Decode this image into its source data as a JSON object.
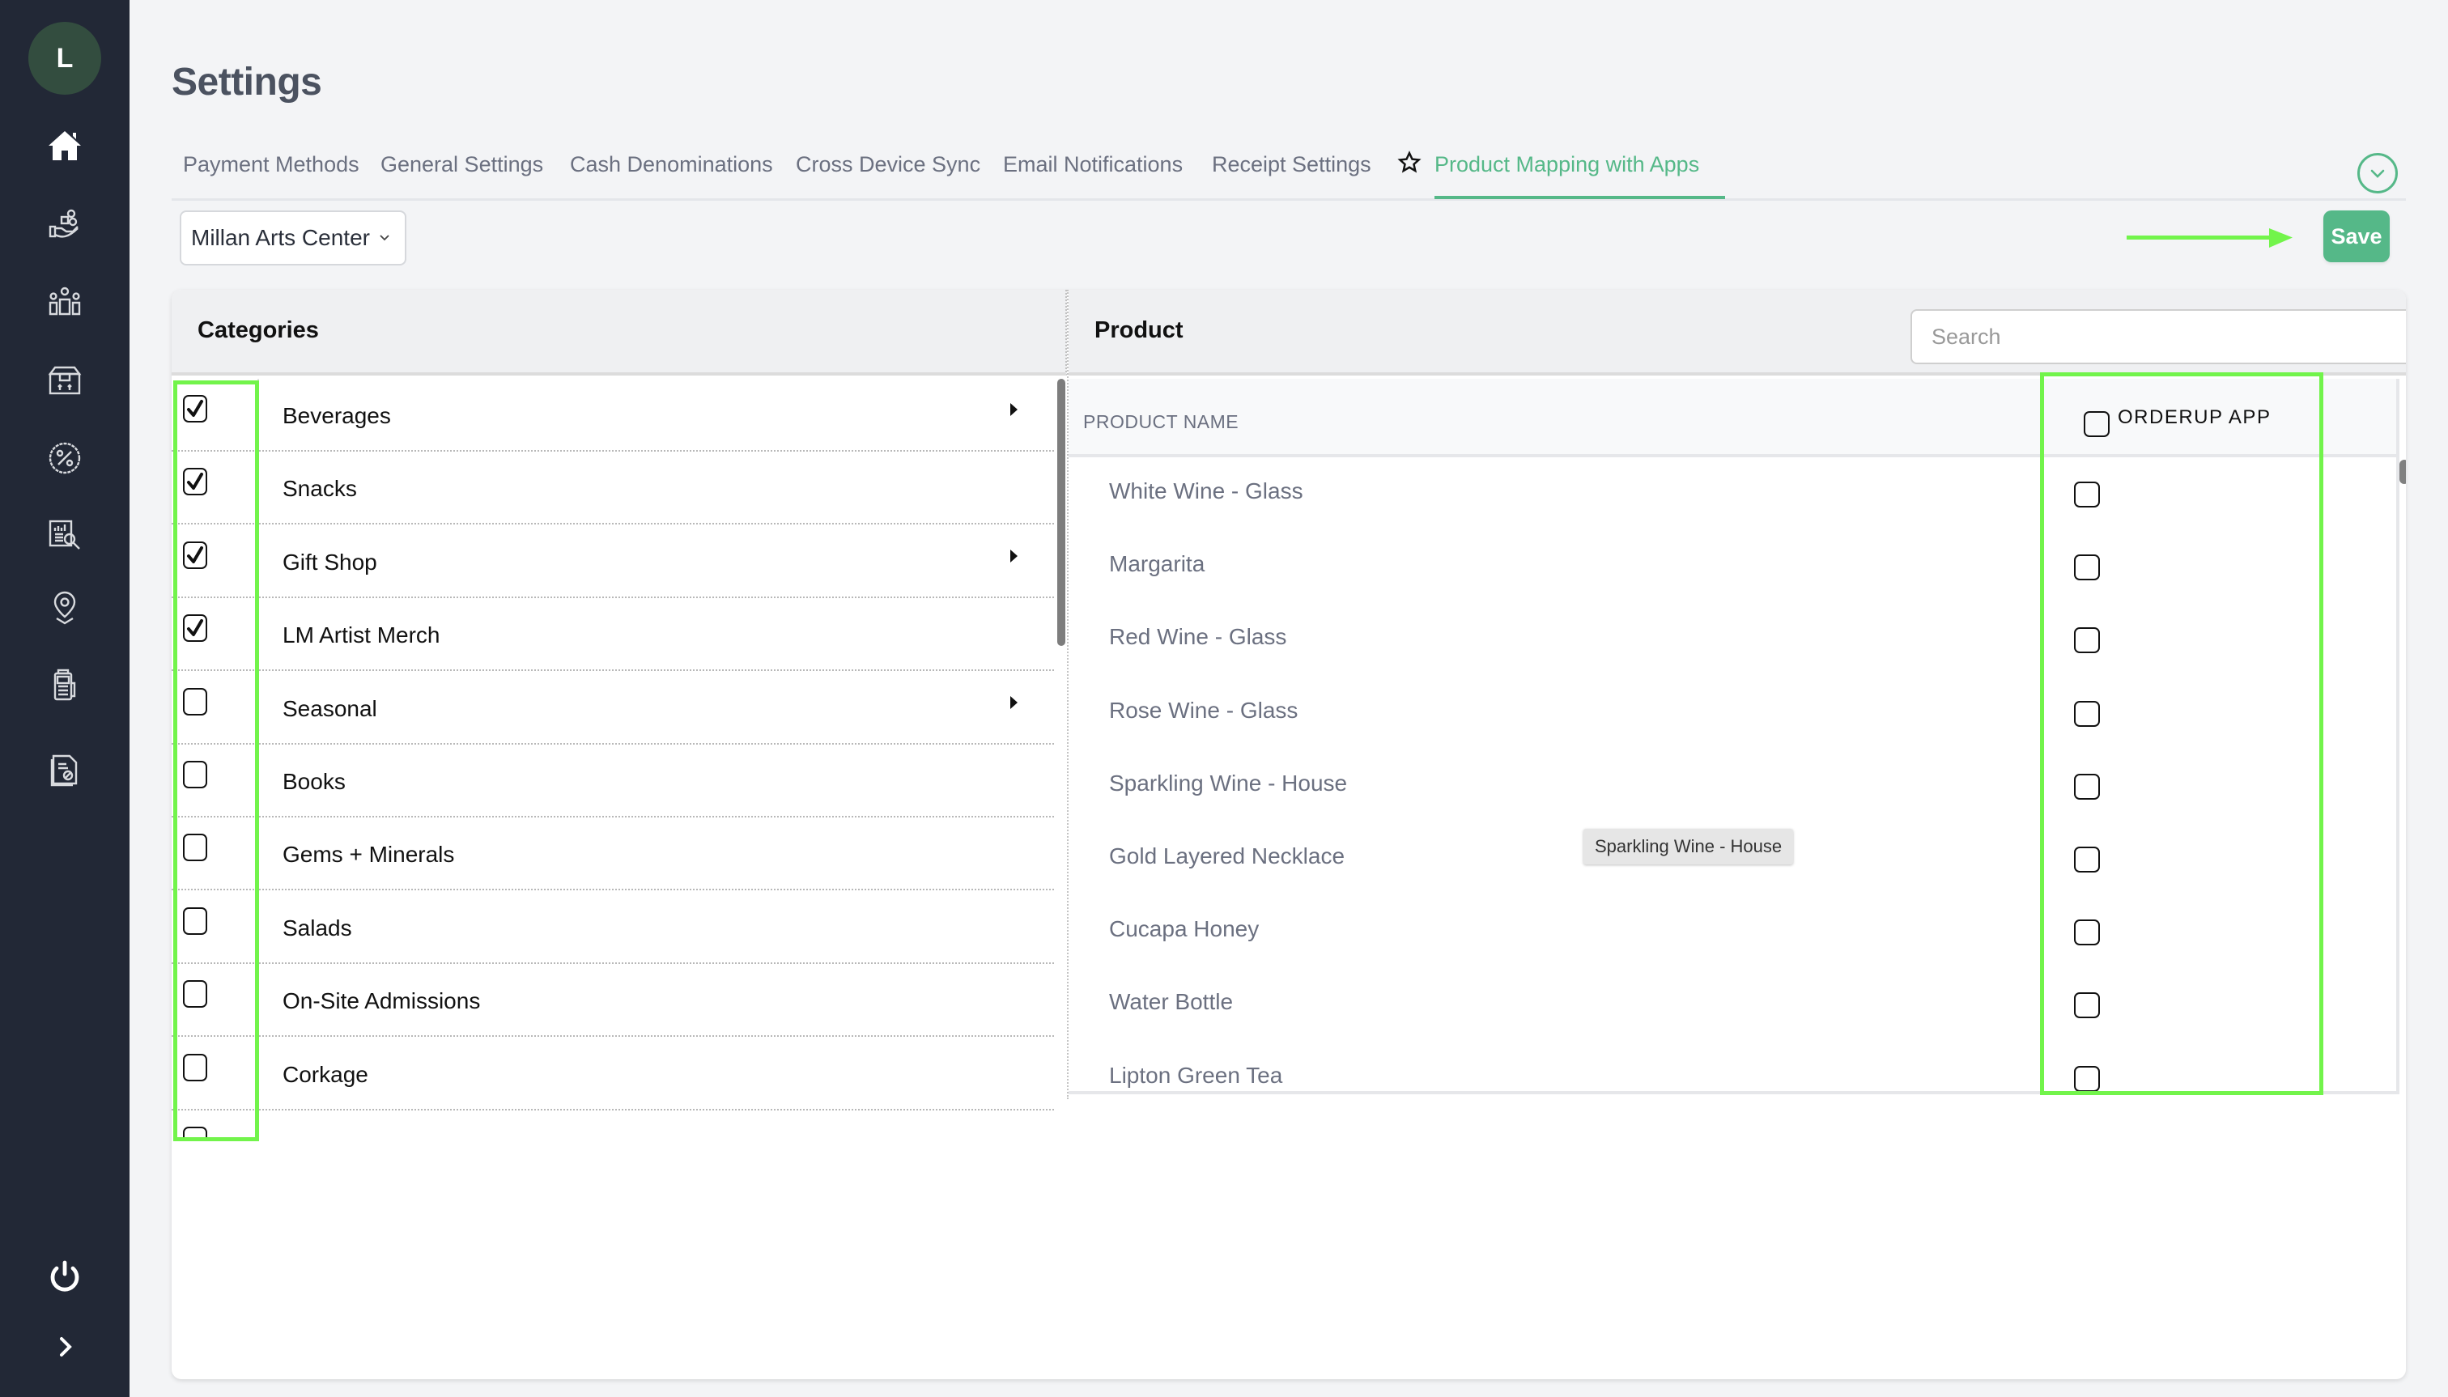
{
  "sidebar": {
    "avatar_initial": "L",
    "items": [
      {
        "icon": "home-icon",
        "label": "Home"
      },
      {
        "icon": "hand-coins-icon",
        "label": "Sales"
      },
      {
        "icon": "team-icon",
        "label": "Team"
      },
      {
        "icon": "inventory-box-icon",
        "label": "Inventory"
      },
      {
        "icon": "discount-percent-icon",
        "label": "Discounts"
      },
      {
        "icon": "report-search-icon",
        "label": "Reports"
      },
      {
        "icon": "location-pin-icon",
        "label": "Locations"
      },
      {
        "icon": "pos-terminal-icon",
        "label": "Devices"
      },
      {
        "icon": "document-settings-icon",
        "label": "Documents"
      }
    ],
    "bottom": [
      {
        "icon": "power-icon",
        "label": "Logout"
      },
      {
        "icon": "chevron-right-icon",
        "label": "Expand"
      }
    ]
  },
  "header": {
    "title": "Settings",
    "tabs": [
      {
        "label": "Payment Methods",
        "active": false
      },
      {
        "label": "General Settings",
        "active": false
      },
      {
        "label": "Cash Denominations",
        "active": false
      },
      {
        "label": "Cross Device Sync",
        "active": false
      },
      {
        "label": "Email Notifications",
        "active": false
      },
      {
        "label": "Receipt Settings",
        "active": false
      },
      {
        "label": "Product Mapping with Apps",
        "active": true,
        "icon": "star-icon"
      }
    ]
  },
  "toolbar": {
    "store_select": "Millan Arts Center",
    "save_label": "Save"
  },
  "categories": {
    "title": "Categories",
    "items": [
      {
        "label": "Beverages",
        "checked": true,
        "has_children": true
      },
      {
        "label": "Snacks",
        "checked": true,
        "has_children": false
      },
      {
        "label": "Gift Shop",
        "checked": true,
        "has_children": true
      },
      {
        "label": "LM Artist Merch",
        "checked": true,
        "has_children": false
      },
      {
        "label": "Seasonal",
        "checked": false,
        "has_children": true
      },
      {
        "label": "Books",
        "checked": false,
        "has_children": false
      },
      {
        "label": "Gems + Minerals",
        "checked": false,
        "has_children": false
      },
      {
        "label": "Salads",
        "checked": false,
        "has_children": false
      },
      {
        "label": "On-Site Admissions",
        "checked": false,
        "has_children": false
      },
      {
        "label": "Corkage",
        "checked": false,
        "has_children": false
      },
      {
        "label": "",
        "checked": false,
        "has_children": false
      }
    ]
  },
  "products": {
    "title": "Product",
    "search_placeholder": "Search",
    "search_value": "",
    "column_name": "PRODUCT NAME",
    "column_app": "ORDERUP APP",
    "column_app_checked": false,
    "items": [
      {
        "name": "White Wine - Glass",
        "orderup": false
      },
      {
        "name": "Margarita",
        "orderup": false
      },
      {
        "name": "Red Wine - Glass",
        "orderup": false
      },
      {
        "name": "Rose Wine - Glass",
        "orderup": false
      },
      {
        "name": "Sparkling Wine - House",
        "orderup": false
      },
      {
        "name": "Gold Layered Necklace",
        "orderup": false
      },
      {
        "name": "Cucapa Honey",
        "orderup": false
      },
      {
        "name": "Water Bottle",
        "orderup": false
      },
      {
        "name": "Lipton Green Tea",
        "orderup": false
      }
    ],
    "tooltip": "Sparkling Wine - House"
  },
  "colors": {
    "accent": "#55b888",
    "sidebar_bg": "#222836",
    "avatar_bg": "#334d3f",
    "annotation": "#72f44b"
  }
}
